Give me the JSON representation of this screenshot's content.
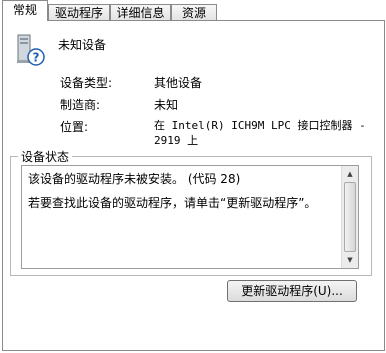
{
  "tabs": [
    "常规",
    "驱动程序",
    "详细信息",
    "资源"
  ],
  "device": {
    "name": "未知设备",
    "icon": "unknown-device-icon"
  },
  "properties": {
    "type_label": "设备类型:",
    "type_value": "其他设备",
    "mfr_label": "制造商:",
    "mfr_value": "未知",
    "location_label": "位置:",
    "location_value": "在 Intel(R) ICH9M LPC 接口控制器 - 2919 上"
  },
  "status": {
    "group_title": "设备状态",
    "line1": "该设备的驱动程序未被安装。 (代码 28)",
    "line2": "若要查找此设备的驱动程序，请单击“更新驱动程序”。"
  },
  "buttons": {
    "update_driver": "更新驱动程序(U)..."
  }
}
